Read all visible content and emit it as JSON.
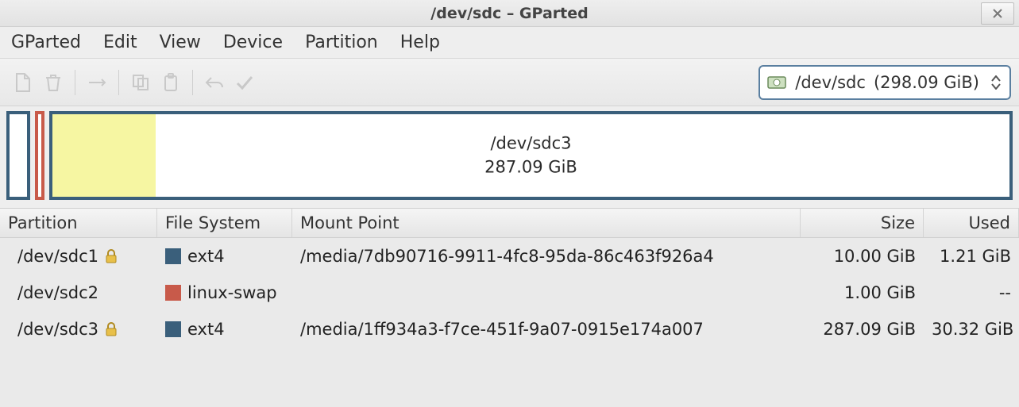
{
  "window": {
    "title": "/dev/sdc – GParted"
  },
  "menu": {
    "gparted": "GParted",
    "edit": "Edit",
    "view": "View",
    "device": "Device",
    "partition": "Partition",
    "help": "Help"
  },
  "device_selector": {
    "device": "/dev/sdc",
    "size": "(298.09 GiB)"
  },
  "map": {
    "big_name": "/dev/sdc3",
    "big_size": "287.09 GiB"
  },
  "columns": {
    "partition": "Partition",
    "filesystem": "File System",
    "mountpoint": "Mount Point",
    "size": "Size",
    "used": "Used"
  },
  "rows": [
    {
      "partition": "/dev/sdc1",
      "locked": true,
      "fs": "ext4",
      "fs_class": "fs-ext4",
      "mount": "/media/7db90716-9911-4fc8-95da-86c463f926a4",
      "size": "10.00 GiB",
      "used": "1.21 GiB"
    },
    {
      "partition": "/dev/sdc2",
      "locked": false,
      "fs": "linux-swap",
      "fs_class": "fs-swap",
      "mount": "",
      "size": "1.00 GiB",
      "used": "--"
    },
    {
      "partition": "/dev/sdc3",
      "locked": true,
      "fs": "ext4",
      "fs_class": "fs-ext4",
      "mount": "/media/1ff934a3-f7ce-451f-9a07-0915e174a007",
      "size": "287.09 GiB",
      "used": "30.32 GiB"
    }
  ]
}
